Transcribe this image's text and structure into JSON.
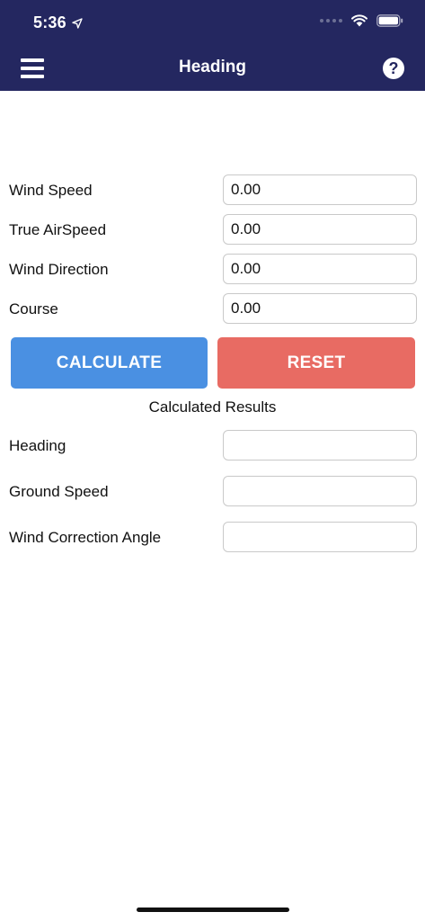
{
  "status_bar": {
    "time": "5:36",
    "location_icon": "location-arrow-icon",
    "wifi_icon": "wifi-icon",
    "battery_icon": "battery-icon"
  },
  "nav": {
    "title": "Heading",
    "menu_icon": "hamburger-menu-icon",
    "help_icon": "help-icon",
    "help_glyph": "?",
    "bar_color": "#242760"
  },
  "inputs": {
    "wind_speed": {
      "label": "Wind Speed",
      "value": "0.00"
    },
    "true_airspeed": {
      "label": "True AirSpeed",
      "value": "0.00"
    },
    "wind_direction": {
      "label": "Wind Direction",
      "value": "0.00"
    },
    "course": {
      "label": "Course",
      "value": "0.00"
    }
  },
  "buttons": {
    "calculate": {
      "label": "CALCULATE",
      "color": "#4a90e2"
    },
    "reset": {
      "label": "RESET",
      "color": "#e86b63"
    }
  },
  "results": {
    "title": "Calculated Results",
    "heading": {
      "label": "Heading",
      "value": ""
    },
    "ground_speed": {
      "label": "Ground Speed",
      "value": ""
    },
    "wind_correction_angle": {
      "label": "Wind Correction Angle",
      "value": ""
    }
  }
}
